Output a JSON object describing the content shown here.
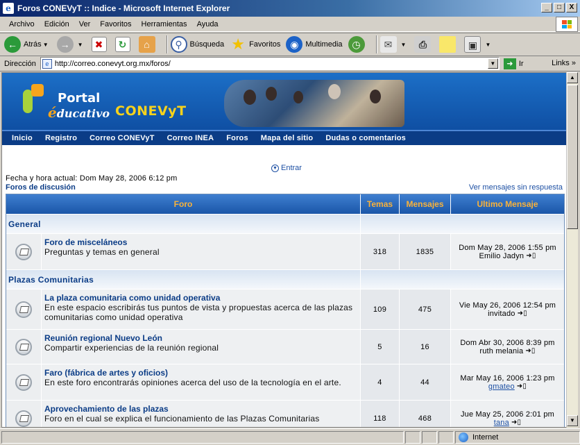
{
  "window": {
    "title": "Foros CONEVyT :: Indice - Microsoft Internet Explorer",
    "buttons": [
      "_",
      "□",
      "X"
    ]
  },
  "menu": [
    "Archivo",
    "Edición",
    "Ver",
    "Favoritos",
    "Herramientas",
    "Ayuda"
  ],
  "toolbar": {
    "back": "Atrás",
    "search": "Búsqueda",
    "favorites": "Favoritos",
    "media": "Multimedia"
  },
  "address": {
    "label": "Dirección",
    "url": "http://correo.conevyt.org.mx/foros/",
    "go": "Ir",
    "links": "Links"
  },
  "banner": {
    "portal": "Portal",
    "educativo_first": "é",
    "educativo_rest": "ducativo",
    "brand": "CONEVyT"
  },
  "nav": [
    "Inicio",
    "Registro",
    "Correo CONEVyT",
    "Correo INEA",
    "Foros",
    "Mapa del sitio",
    "Dudas o comentarios"
  ],
  "login": "Entrar",
  "current_time": "Fecha y hora actual: Dom May 28, 2006 6:12 pm",
  "forum_home": "Foros de discusión",
  "unread_link": "Ver mensajes sin respuesta",
  "table": {
    "headers": {
      "forum": "Foro",
      "topics": "Temas",
      "posts": "Mensajes",
      "last": "Ultimo Mensaje"
    },
    "categories": [
      {
        "name": "General",
        "forums": [
          {
            "name": "Foro de misceláneos",
            "desc": "Preguntas y temas en general",
            "topics": "318",
            "posts": "1835",
            "last_date": "Dom May 28, 2006 1:55 pm",
            "last_user": "Emilio Jadyn",
            "user_link": false
          }
        ]
      },
      {
        "name": "Plazas Comunitarias",
        "forums": [
          {
            "name": "La plaza comunitaria como unidad operativa",
            "desc": "En este espacio escribirás tus puntos de vista y propuestas acerca de las plazas comunitarias como unidad operativa",
            "topics": "109",
            "posts": "475",
            "last_date": "Vie May 26, 2006 12:54 pm",
            "last_user": "invitado",
            "user_link": false
          },
          {
            "name": "Reunión regional Nuevo León",
            "desc": "Compartir experiencias de la reunión regional",
            "topics": "5",
            "posts": "16",
            "last_date": "Dom Abr 30, 2006 8:39 pm",
            "last_user": "ruth melania",
            "user_link": false
          },
          {
            "name": "Faro (fábrica de artes y oficios)",
            "desc": "En este foro encontrarás opiniones acerca del uso de la tecnología en el arte.",
            "topics": "4",
            "posts": "44",
            "last_date": "Mar May 16, 2006 1:23 pm",
            "last_user": "gmateo",
            "user_link": true
          },
          {
            "name": "Aprovechamiento de las plazas",
            "desc": "Foro en el cual se explica el funcionamiento de las Plazas Comunitarias",
            "topics": "118",
            "posts": "468",
            "last_date": "Jue May 25, 2006 2:01 pm",
            "last_user": "tana",
            "user_link": true
          }
        ]
      }
    ]
  },
  "status": {
    "zone": "Internet"
  }
}
